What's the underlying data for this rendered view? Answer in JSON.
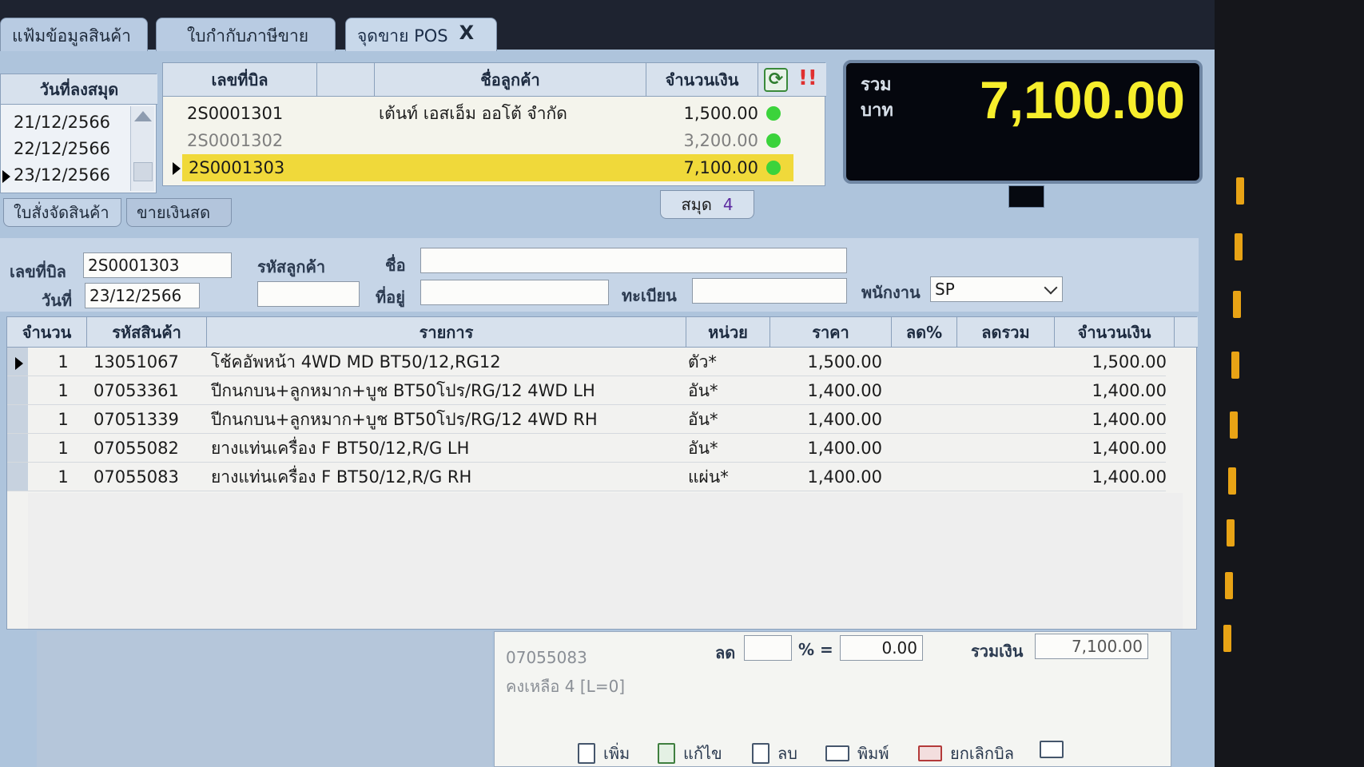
{
  "tabs": [
    {
      "label": "แฟ้มข้อมูลสินค้า"
    },
    {
      "label": "ใบกำกับภาษีขาย"
    },
    {
      "label": "จุดขาย POS",
      "close": "X"
    }
  ],
  "dates": {
    "header": "วันที่ลงสมุด",
    "items": [
      "21/12/2566",
      "22/12/2566",
      "23/12/2566"
    ]
  },
  "bills": {
    "headers": {
      "bill_no": "เลขที่บิล",
      "customer": "ชื่อลูกค้า",
      "amount": "จำนวนเงิน",
      "alert": "!!"
    },
    "rows": [
      {
        "bill_no": "2S0001301",
        "customer": "เต้นท์ เอสเอ็ม ออโต้ จำกัด",
        "amount": "1,500.00"
      },
      {
        "bill_no": "2S0001302",
        "customer": "",
        "amount": "3,200.00"
      },
      {
        "bill_no": "2S0001303",
        "customer": "",
        "amount": "7,100.00"
      }
    ]
  },
  "total": {
    "label_line1": "รวม",
    "label_line2": "บาท",
    "value": "7,100.00"
  },
  "subtabs": [
    "ใบสั่งจัดสินค้า",
    "ขายเงินสด"
  ],
  "count_tab": {
    "label": "สมุด",
    "value": "4"
  },
  "form": {
    "bill_no_label": "เลขที่บิล",
    "bill_no": "2S0001303",
    "date_label": "วันที่",
    "date": "23/12/2566",
    "customer_code_label": "รหัสลูกค้า",
    "name_label": "ชื่อ",
    "address_label": "ที่อยู่",
    "register_label": "ทะเบียน",
    "staff_label": "พนักงาน",
    "staff": "SP"
  },
  "items": {
    "headers": {
      "qty": "จำนวน",
      "code": "รหัสสินค้า",
      "desc": "รายการ",
      "unit": "หน่วย",
      "price": "ราคา",
      "disc_pct": "ลด%",
      "disc_total": "ลดรวม",
      "amount": "จำนวนเงิน"
    },
    "rows": [
      {
        "qty": "1",
        "code": "13051067",
        "desc": "โช้คอัพหน้า 4WD  MD BT50/12,RG12",
        "unit": "ตัว*",
        "price": "1,500.00",
        "amount": "1,500.00"
      },
      {
        "qty": "1",
        "code": "07053361",
        "desc": "ปีกนกบน+ลูกหมาก+บูช  BT50โปร/RG/12 4WD LH",
        "unit": "อัน*",
        "price": "1,400.00",
        "amount": "1,400.00"
      },
      {
        "qty": "1",
        "code": "07051339",
        "desc": "ปีกนกบน+ลูกหมาก+บูช  BT50โปร/RG/12 4WD RH",
        "unit": "อัน*",
        "price": "1,400.00",
        "amount": "1,400.00"
      },
      {
        "qty": "1",
        "code": "07055082",
        "desc": "ยางแท่นเครื่อง  F BT50/12,R/G  LH",
        "unit": "อัน*",
        "price": "1,400.00",
        "amount": "1,400.00"
      },
      {
        "qty": "1",
        "code": "07055083",
        "desc": "ยางแท่นเครื่อง  F BT50/12,R/G  RH",
        "unit": "แผ่น*",
        "price": "1,400.00",
        "amount": "1,400.00"
      }
    ]
  },
  "summary": {
    "selected_code": "07055083",
    "remaining": "คงเหลือ  4  [L=0]",
    "discount_label": "ลด",
    "percent_sign": "% =",
    "discount_value": "0.00",
    "sum_label": "รวมเงิน",
    "sum_value": "7,100.00"
  },
  "toolbar": {
    "add": "เพิ่ม",
    "edit": "แก้ไข",
    "delete": "ลบ",
    "print": "พิมพ์",
    "cancel_bill": "ยกเลิกบิล"
  },
  "colors": {
    "total_text": "#f7ee2c",
    "selected_row": "#f0d93a",
    "status_dot": "#3bd33b"
  }
}
